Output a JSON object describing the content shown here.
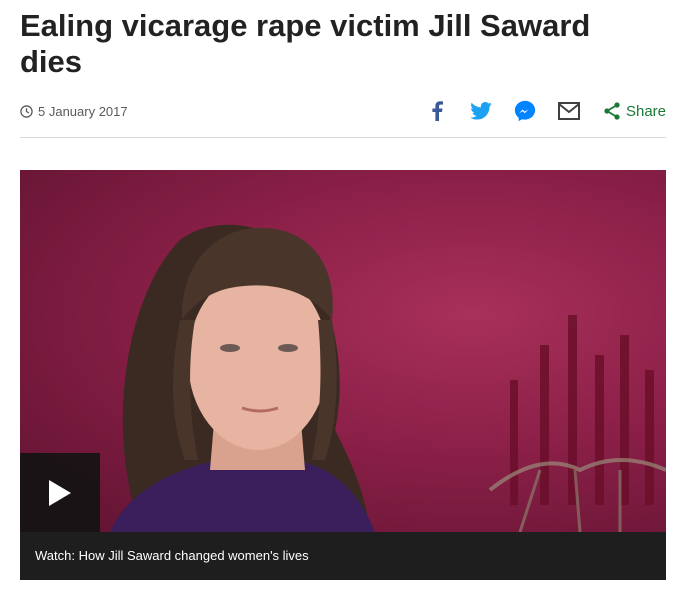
{
  "article": {
    "headline": "Ealing vicarage rape victim Jill Saward dies",
    "date": "5 January 2017"
  },
  "share": {
    "items": [
      {
        "icon": "facebook-icon",
        "color": "#3b5998"
      },
      {
        "icon": "twitter-icon",
        "color": "#1da1f2"
      },
      {
        "icon": "messenger-icon",
        "color": "#0084ff"
      },
      {
        "icon": "email-icon",
        "color": "#404040"
      }
    ],
    "label": "Share",
    "accent": "#1b7837"
  },
  "media": {
    "caption": "Watch: How Jill Saward changed women's lives",
    "play_icon": "play-icon"
  }
}
